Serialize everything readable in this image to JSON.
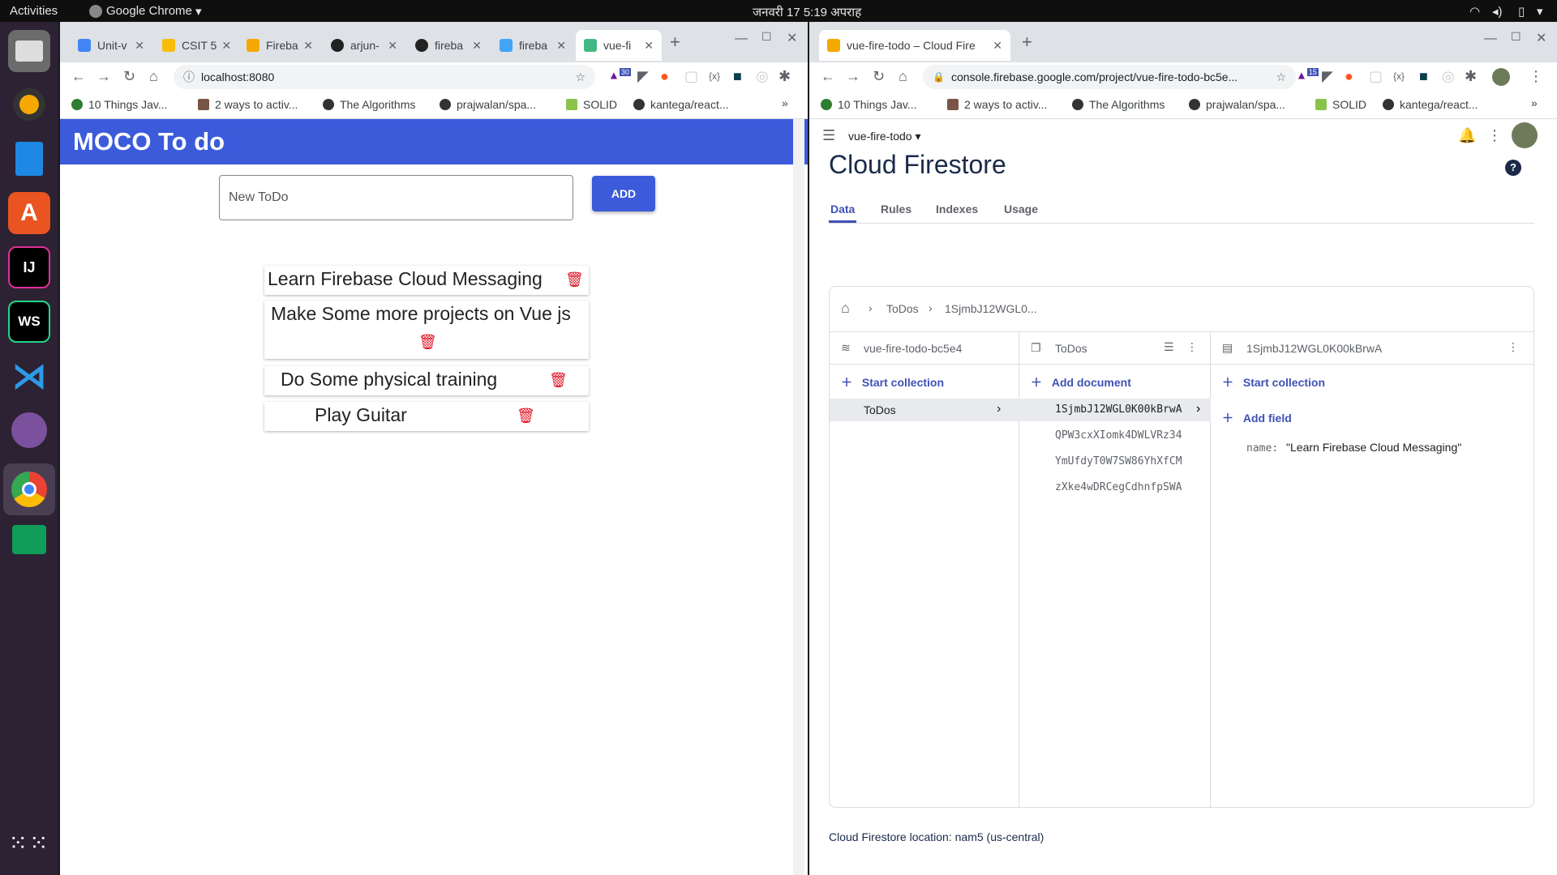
{
  "topbar": {
    "activities": "Activities",
    "app": "Google Chrome",
    "datetime": "जनवरी 17  5:19 अपराह"
  },
  "dock": {
    "icons": [
      "files-icon",
      "rhythmbox-icon",
      "writer-icon",
      "app-center-icon",
      "intellij-icon",
      "webstorm-icon",
      "vscode-icon",
      "viber-icon",
      "chrome-icon",
      "chat-icon",
      "app-grid-icon"
    ]
  },
  "left": {
    "tabs": [
      "Unit-v",
      "CSIT 5",
      "Fireba",
      "arjun-",
      "fireba",
      "fireba",
      "vue-fi"
    ],
    "url": "localhost:8080",
    "ext_badge": "30",
    "bookmarks": [
      "10 Things Jav...",
      "2 ways to activ...",
      "The Algorithms",
      "prajwalan/spa...",
      "SOLID",
      "kantega/react..."
    ],
    "app": {
      "title": "MOCO To do",
      "input_placeholder": "New ToDo",
      "add": "ADD",
      "todos": [
        "Learn Firebase Cloud Messaging",
        "Make Some more projects on Vue js",
        "Do Some physical training",
        "Play Guitar"
      ]
    }
  },
  "right": {
    "tab": "vue-fire-todo – Cloud Fire",
    "url": "console.firebase.google.com/project/vue-fire-todo-bc5e...",
    "ext_badge": "15",
    "bookmarks": [
      "10 Things Jav...",
      "2 ways to activ...",
      "The Algorithms",
      "prajwalan/spa...",
      "SOLID",
      "kantega/react..."
    ],
    "project": "vue-fire-todo",
    "heading": "Cloud Firestore",
    "tabs": [
      "Data",
      "Rules",
      "Indexes",
      "Usage"
    ],
    "breadcrumb": [
      "ToDos",
      "1SjmbJ12WGL0..."
    ],
    "col1": {
      "title": "vue-fire-todo-bc5e4",
      "action": "Start collection",
      "items": [
        "ToDos"
      ]
    },
    "col2": {
      "title": "ToDos",
      "action": "Add document",
      "items": [
        "1SjmbJ12WGL0K00kBrwA",
        "QPW3cxXIomk4DWLVRz34",
        "YmUfdyT0W7SW86YhXfCM",
        "zXke4wDRCegCdhnfpSWA"
      ]
    },
    "col3": {
      "title": "1SjmbJ12WGL0K00kBrwA",
      "action": "Start collection",
      "add_field": "Add field",
      "field_key": "name:",
      "field_value": "\"Learn Firebase Cloud Messaging\""
    },
    "location": "Cloud Firestore location: nam5 (us-central)"
  }
}
